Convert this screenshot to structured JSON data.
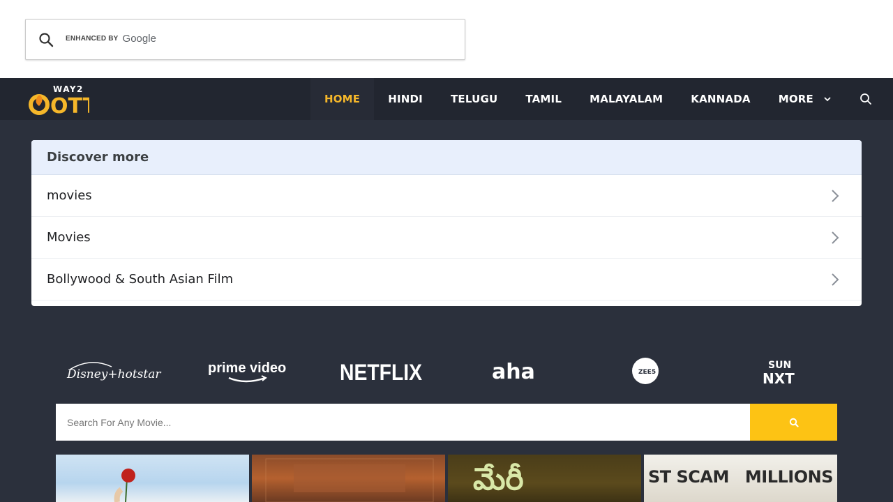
{
  "top_search": {
    "enhanced_by": "ENHANCED BY",
    "google": "Google"
  },
  "navbar": {
    "logo_small": "WAY2",
    "logo_big": "OTT",
    "items": [
      {
        "label": "HOME",
        "active": true
      },
      {
        "label": "HINDI"
      },
      {
        "label": "TELUGU"
      },
      {
        "label": "TAMIL"
      },
      {
        "label": "MALAYALAM"
      },
      {
        "label": "KANNADA"
      },
      {
        "label": "MORE"
      }
    ],
    "accent": "#f5b72a"
  },
  "discover": {
    "title": "Discover more",
    "items": [
      "movies",
      "Movies",
      "Bollywood & South Asian Film"
    ]
  },
  "ott_logos": [
    {
      "name": "disney-hotstar",
      "text": "Disney+hotstar"
    },
    {
      "name": "prime-video",
      "text": "prime video"
    },
    {
      "name": "netflix",
      "text": "NETFLIX"
    },
    {
      "name": "aha",
      "text": "aha"
    },
    {
      "name": "zee5",
      "text": "ZEE5"
    },
    {
      "name": "sun-nxt",
      "text_top": "SUN",
      "text_bottom": "NXT"
    }
  ],
  "movie_search": {
    "placeholder": "Search For Any Movie...",
    "button_color": "#fdc314"
  },
  "posters": {
    "p3_text": "మేరీ",
    "p4_left": "ST SCAM",
    "p4_right": "MILLIONS"
  }
}
